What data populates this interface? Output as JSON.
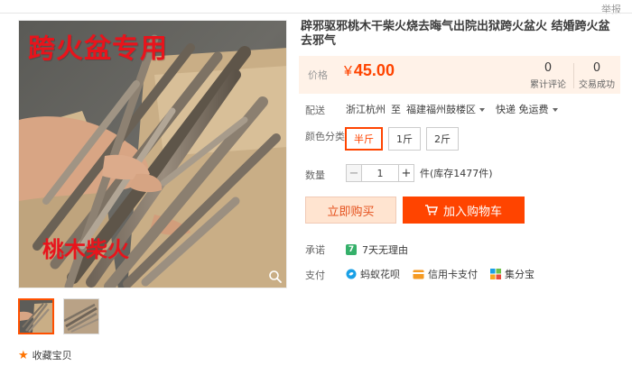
{
  "header": {
    "report_label": "举报"
  },
  "gallery": {
    "overlay_top": "跨火盆专用",
    "overlay_bottom": "桃木柴火",
    "zoom_icon": "magnifier-icon"
  },
  "product": {
    "title": "辟邪驱邪桃木干柴火烧去晦气出院出狱跨火盆火 结婚跨火盆去邪气",
    "price_label": "价格",
    "currency": "¥",
    "price": "45.00",
    "reviews_count": "0",
    "reviews_label": "累计评论",
    "sales_count": "0",
    "sales_label": "交易成功"
  },
  "shipping": {
    "label": "配送",
    "from": "浙江杭州",
    "to_word": "至",
    "destination": "福建福州鼓楼区",
    "method": "快递 免运费"
  },
  "sku": {
    "label": "颜色分类",
    "options": [
      "半斤",
      "1斤",
      "2斤"
    ],
    "selected": "半斤"
  },
  "quantity": {
    "label": "数量",
    "value": "1",
    "minus": "−",
    "plus": "+",
    "stock": "件(库存1477件)"
  },
  "actions": {
    "buy_now": "立即购买",
    "add_cart": "加入购物车"
  },
  "promise": {
    "label": "承诺",
    "icon_text": "7",
    "text": "7天无理由"
  },
  "payment": {
    "label": "支付",
    "methods": [
      "蚂蚁花呗",
      "信用卡支付",
      "集分宝"
    ]
  },
  "favorite": {
    "label": "收藏宝贝"
  },
  "colors": {
    "accent": "#ff4400",
    "price_bg": "#fff2e8",
    "buy_now_bg": "#ffe4d0"
  }
}
